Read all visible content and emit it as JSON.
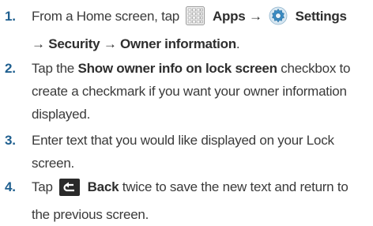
{
  "steps": [
    {
      "number": "1.",
      "line1_pre": "From a Home screen, tap",
      "apps_icon": "apps-grid-icon",
      "apps_label": "Apps",
      "arrow": "→",
      "settings_icon": "gear-icon",
      "settings_label": "Settings",
      "line2_arrow": "→",
      "security_label": "Security",
      "line2_arrow2": "→",
      "owner_info_label": "Owner information",
      "end": "."
    },
    {
      "number": "2.",
      "pre": "Tap the",
      "bold": "Show owner info on lock screen",
      "post_line1": "checkbox to",
      "line2": "create a checkmark if you want your owner information",
      "line3": "displayed."
    },
    {
      "number": "3.",
      "line1": "Enter text that you would like displayed on your Lock",
      "line2": "screen."
    },
    {
      "number": "4.",
      "pre": "Tap",
      "back_icon": "back-arrow-icon",
      "back_label": "Back",
      "post_line1": "twice to save the new text and return to",
      "line2": "the previous screen."
    }
  ],
  "colors": {
    "step_number": "#1f5f8f",
    "text": "#3a3a3a",
    "back_icon_bg": "#2a2a2a"
  }
}
